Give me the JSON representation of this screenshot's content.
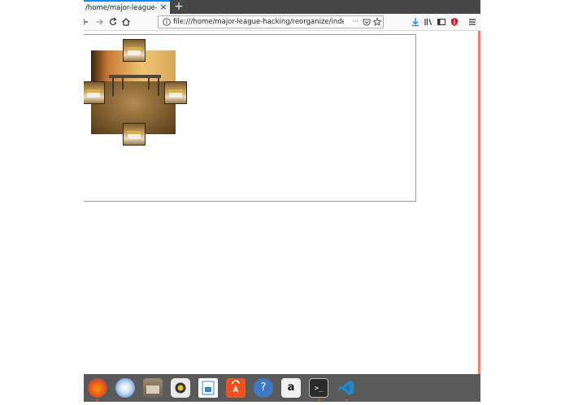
{
  "browser": {
    "tab_title": "/home/major-league-hacking",
    "tab_close": "×",
    "new_tab": "+",
    "url": "file:///home/major-league-hacking/reorganize/index.html",
    "url_more": "···",
    "icons": {
      "back": "back-icon",
      "forward": "forward-icon",
      "reload": "reload-icon",
      "home": "home-icon",
      "info": "info-icon",
      "pocket": "pocket-icon",
      "bookmark": "star-icon",
      "download": "download-icon",
      "library": "library-icon",
      "sidebar": "sidebar-icon",
      "shield": "shield-icon",
      "menu": "menu-icon"
    }
  },
  "page": {
    "images": [
      "room-photo",
      "chair-photo-top",
      "chair-photo-left",
      "chair-photo-right",
      "chair-photo-bottom"
    ]
  },
  "dock": {
    "apps": [
      "firefox-icon",
      "thunderbird-icon",
      "files-icon",
      "rhythmbox-icon",
      "libreoffice-writer-icon",
      "software-center-icon",
      "help-icon",
      "amazon-icon",
      "terminal-icon",
      "vscode-icon"
    ],
    "help_glyph": "?",
    "terminal_glyph": ">_",
    "amazon_glyph": "a"
  },
  "colors": {
    "tab_accent": "#0a84ff",
    "tabstrip": "#474747",
    "dock": "#5a5a5a",
    "running_indicator": "#e95420"
  }
}
